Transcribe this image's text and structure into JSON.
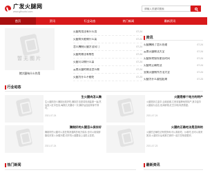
{
  "header": {
    "logo_title": "广发火腿网",
    "logo_url": "www.gfhuotui.com",
    "search_placeholder": "请输入关键词搜索"
  },
  "nav": {
    "items": [
      {
        "label": "首页",
        "active": true
      },
      {
        "label": "资讯",
        "active": false
      },
      {
        "label": "行业动态",
        "active": false
      },
      {
        "label": "热门新闻",
        "active": false
      },
      {
        "label": "最新资讯",
        "active": false
      }
    ]
  },
  "hero": {
    "placeholder_text": "暂无图片",
    "caption": "猪大腿有什么作用"
  },
  "mid_list": [
    {
      "title": "火腿的用法有什么用",
      "date": "07-24"
    },
    {
      "title": "火腿骨头能做什么菜",
      "date": "07-24"
    },
    {
      "title": "怎么腌制火腿方法窍门",
      "date": "07-24"
    },
    {
      "title": "火腿的做法有哪些",
      "date": "07-24"
    },
    {
      "title": "火腿可以做什么菜",
      "date": "07-24"
    },
    {
      "title": "云南火腿的做法怎么做",
      "date": "07-24"
    },
    {
      "title": "火腿为什么不能吃",
      "date": "07-23"
    }
  ],
  "news_box": {
    "title": "资讯",
    "items": [
      {
        "title": "火腿腌制了怎么处理",
        "date": "07-24"
      },
      {
        "title": "云南火腿做法大全",
        "date": "07-24"
      },
      {
        "title": "火腿如何保存更长时间",
        "date": "07-24"
      },
      {
        "title": "火腿的正确吃法",
        "date": "07-24"
      },
      {
        "title": "宣威火腿制作方法大全",
        "date": "07-24"
      },
      {
        "title": "火腿为什么要挂起来",
        "date": "07-23"
      }
    ]
  },
  "section_industry": {
    "title": "行业动态",
    "cards": [
      {
        "title": "生火腿肉怎么腌",
        "desc": "生火腿肉怎么腌制比较好吃,腌制方法是将肉用盐擦一遍,然后放入缸中压实,每隔几天翻动一次,腌好后挂起来晾干即可。",
        "date": "2021-07-24"
      },
      {
        "title": "火腿是哪个地方的特产",
        "desc": "火腿是浙江金华,云南宣威,江西安福等地的特产,其中金华火腿最为出名,色泽鲜艳,红白分明,肉质香甜。",
        "date": "2021-07-24"
      },
      {
        "title": "腌制好的火腿怎么保存好",
        "desc": "腌制好的火腿可以挂在阴凉通风的地方保存,也可以用保鲜膜包好放入冰箱冷藏,切开的火腿要涂上油防止变质。",
        "date": "2021-07-24"
      },
      {
        "title": "火腿的正确吃法是怎样的",
        "desc": "火腿的正确吃法有很多种,可以蒸着吃、炒着吃,也可以用来煲汤,火腿切片后和其它食材一起烹饪味道更好。",
        "date": "2021-07-23"
      }
    ]
  },
  "section_hot": {
    "title": "热门新闻"
  },
  "section_latest": {
    "title": "最新资讯"
  },
  "colors": {
    "brand_red": "#d8191b",
    "nav_active": "#a91010"
  }
}
